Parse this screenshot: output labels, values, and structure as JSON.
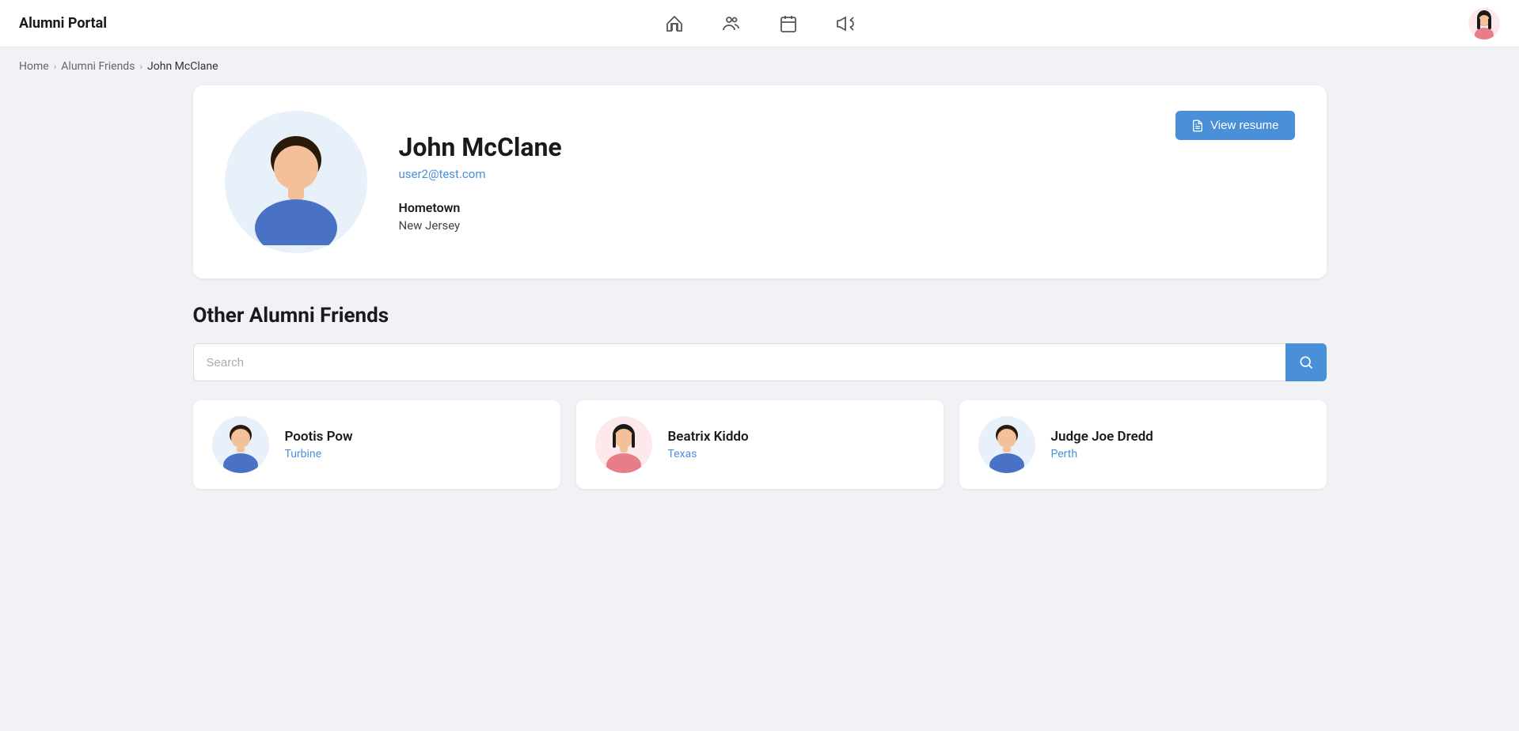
{
  "app": {
    "title": "Alumni Portal"
  },
  "nav": {
    "home_icon": "home",
    "alumni_icon": "people",
    "calendar_icon": "calendar",
    "announcement_icon": "megaphone"
  },
  "breadcrumb": {
    "home": "Home",
    "alumni_friends": "Alumni Friends",
    "current": "John McClane"
  },
  "profile": {
    "name": "John McClane",
    "email": "user2@test.com",
    "hometown_label": "Hometown",
    "hometown_value": "New Jersey",
    "view_resume_label": "View resume"
  },
  "other_alumni": {
    "section_title": "Other Alumni Friends",
    "search_placeholder": "Search",
    "cards": [
      {
        "id": 1,
        "name": "Pootis Pow",
        "location": "Turbine",
        "gender": "male"
      },
      {
        "id": 2,
        "name": "Beatrix Kiddo",
        "location": "Texas",
        "gender": "female"
      },
      {
        "id": 3,
        "name": "Judge Joe Dredd",
        "location": "Perth",
        "gender": "male"
      }
    ]
  }
}
